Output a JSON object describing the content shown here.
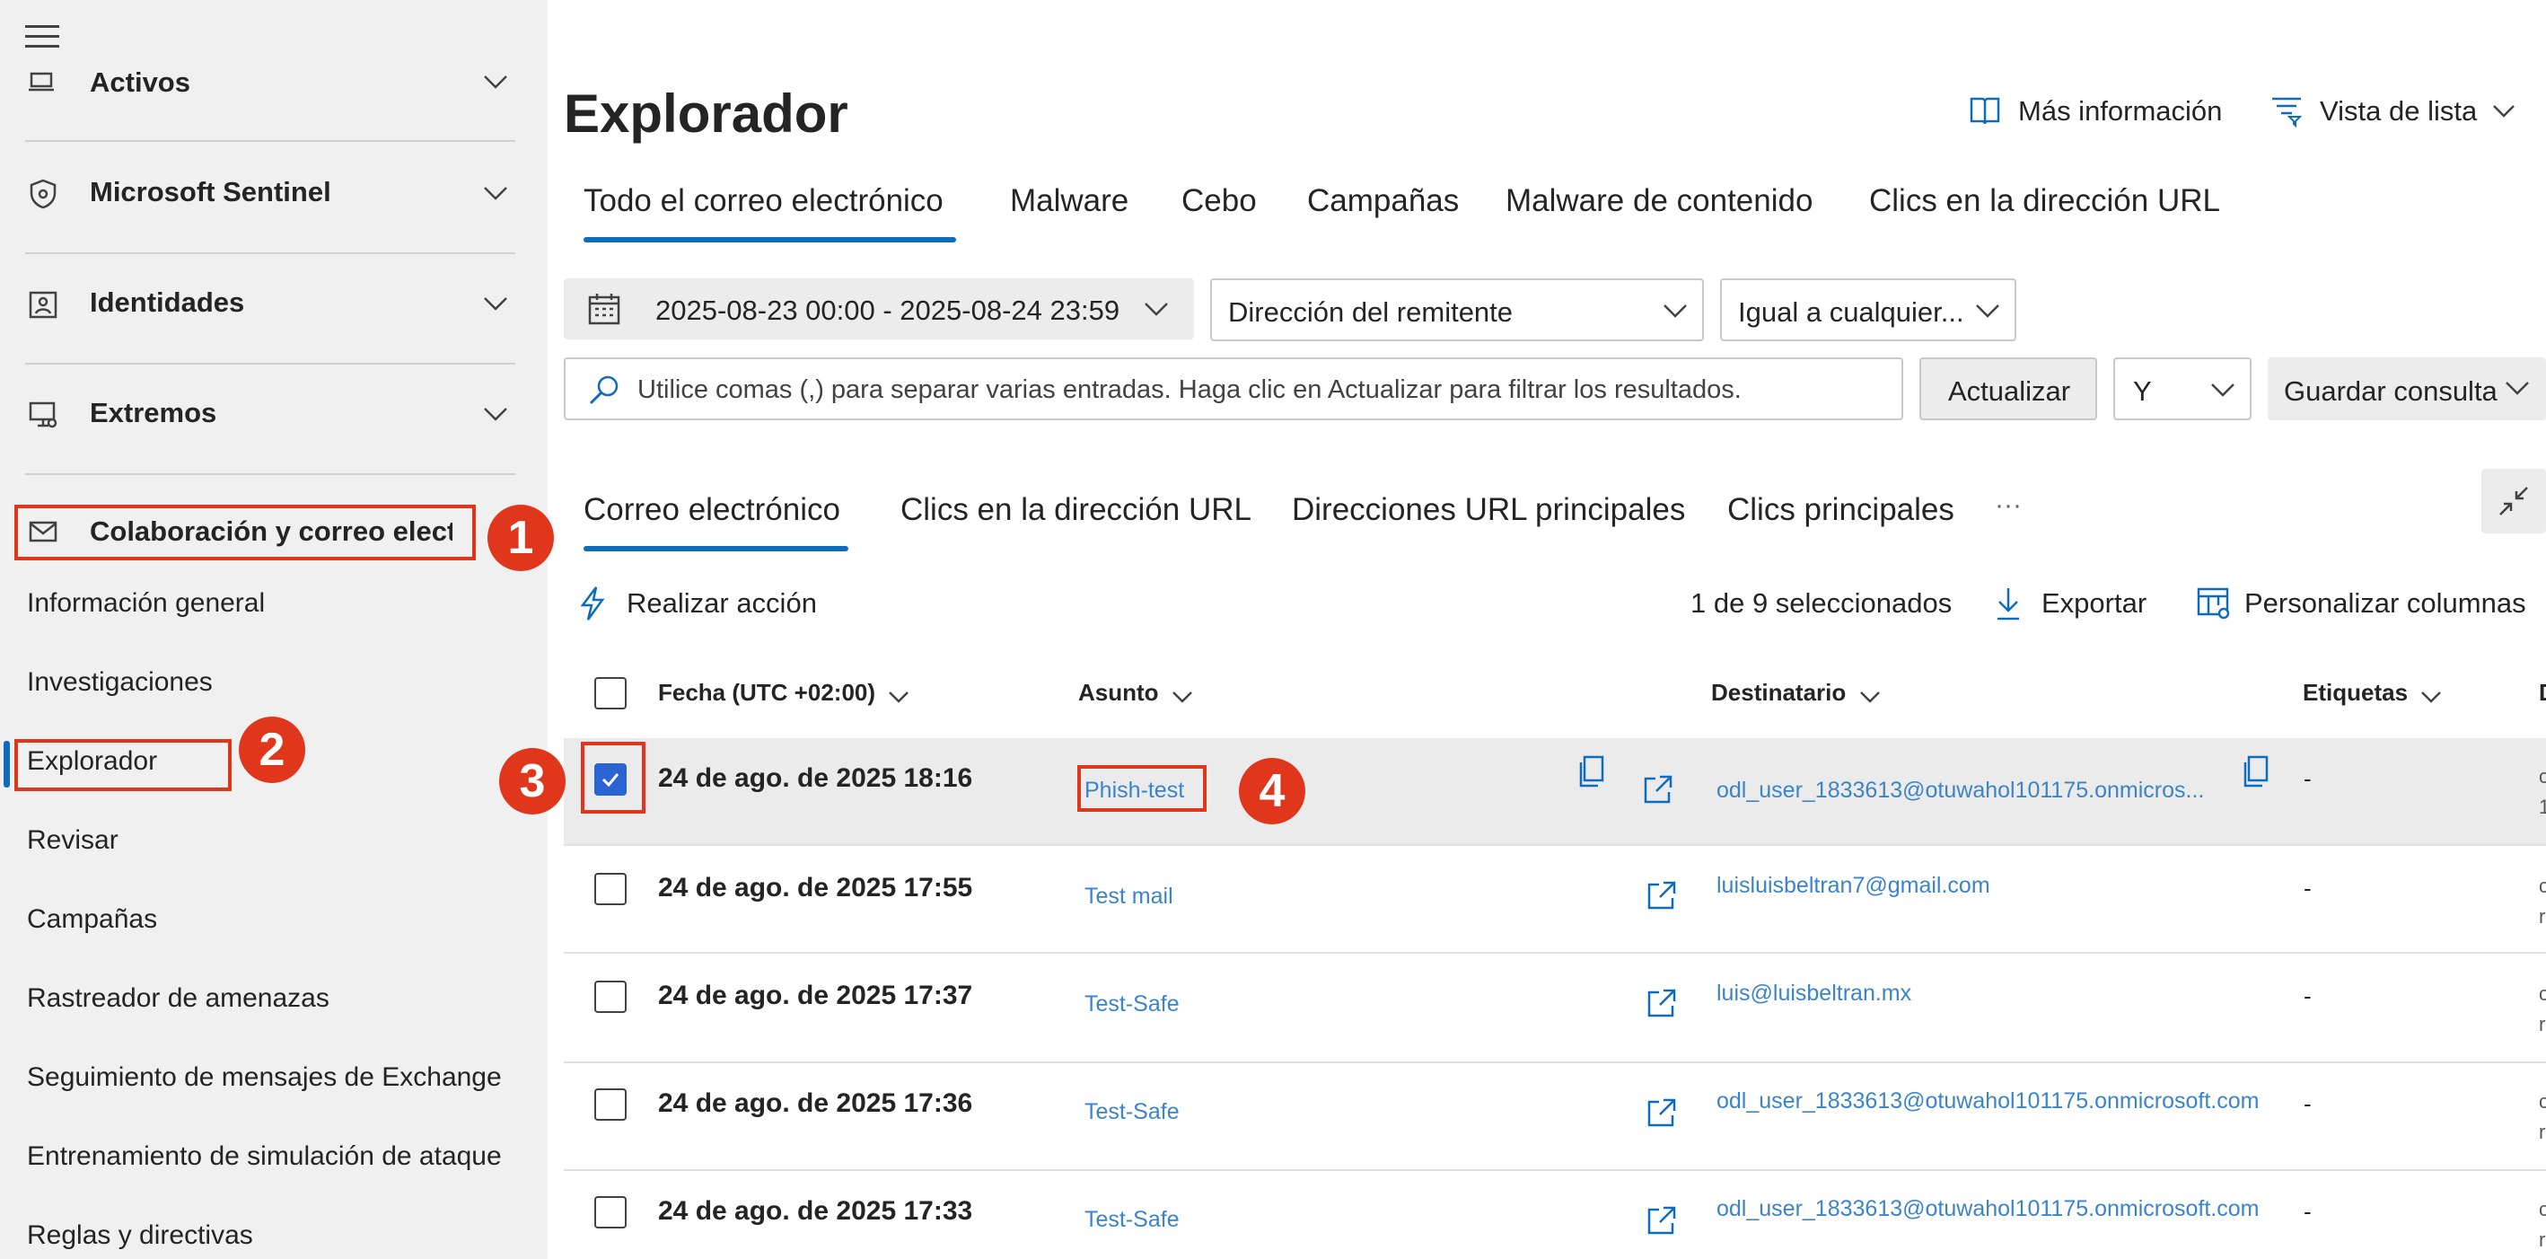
{
  "sidebar": {
    "groups": [
      {
        "label": "Activos",
        "icon": "devices-icon"
      },
      {
        "label": "Microsoft Sentinel",
        "icon": "shield-eye-icon"
      },
      {
        "label": "Identidades",
        "icon": "identity-card-icon"
      },
      {
        "label": "Extremos",
        "icon": "endpoint-device-icon"
      },
      {
        "label": "Colaboración y correo electró",
        "icon": "mail-icon"
      }
    ],
    "items": [
      {
        "label": "Información general"
      },
      {
        "label": "Investigaciones"
      },
      {
        "label": "Explorador"
      },
      {
        "label": "Revisar"
      },
      {
        "label": "Campañas"
      },
      {
        "label": "Rastreador de amenazas"
      },
      {
        "label": "Seguimiento de mensajes de Exchange"
      },
      {
        "label": "Entrenamiento de simulación de ataque"
      },
      {
        "label": "Reglas y directivas"
      }
    ]
  },
  "badges": [
    "1",
    "2",
    "3",
    "4"
  ],
  "header": {
    "title": "Explorador",
    "more_info": "Más información",
    "list_view": "Vista de lista"
  },
  "tabs": [
    {
      "label": "Todo el correo electrónico"
    },
    {
      "label": "Malware"
    },
    {
      "label": "Cebo"
    },
    {
      "label": "Campañas"
    },
    {
      "label": "Malware de contenido"
    },
    {
      "label": "Clics en la dirección URL"
    }
  ],
  "filters": {
    "date_range": "2025-08-23 00:00 - 2025-08-24 23:59",
    "field": "Dirección del remitente",
    "operator": "Igual a cualquier...",
    "search_placeholder": "Utilice comas (,) para separar varias entradas. Haga clic en Actualizar para filtrar los resultados.",
    "refresh": "Actualizar",
    "logic": "Y",
    "save_query": "Guardar consulta"
  },
  "subtabs": [
    {
      "label": "Correo electrónico"
    },
    {
      "label": "Clics en la dirección URL"
    },
    {
      "label": "Direcciones URL principales"
    },
    {
      "label": "Clics principales"
    }
  ],
  "subtabs_more": "···",
  "toolbar": {
    "take_action": "Realizar acción",
    "selection": "1 de 9 seleccionados",
    "export": "Exportar",
    "customize": "Personalizar columnas"
  },
  "columns": {
    "date": "Fecha (UTC +02:00)",
    "subject": "Asunto",
    "recipient": "Destinatario",
    "tags": "Etiquetas",
    "next": "D"
  },
  "rows": [
    {
      "date": "24 de ago. de 2025 18:16",
      "subject": "Phish-test",
      "recipient": "odl_user_1833613@otuwahol101175.onmicros...",
      "tags": "-",
      "edge": "c",
      "edge2": "1",
      "checked": true
    },
    {
      "date": "24 de ago. de 2025 17:55",
      "subject": "Test mail",
      "recipient": "luisluisbeltran7@gmail.com",
      "tags": "-",
      "edge": "c",
      "edge2": "r",
      "checked": false
    },
    {
      "date": "24 de ago. de 2025 17:37",
      "subject": "Test-Safe",
      "recipient": "luis@luisbeltran.mx",
      "tags": "-",
      "edge": "c",
      "edge2": "r",
      "checked": false
    },
    {
      "date": "24 de ago. de 2025 17:36",
      "subject": "Test-Safe",
      "recipient": "odl_user_1833613@otuwahol101175.onmicrosoft.com",
      "tags": "-",
      "edge": "c",
      "edge2": "r",
      "checked": false
    },
    {
      "date": "24 de ago. de 2025 17:33",
      "subject": "Test-Safe",
      "recipient": "odl_user_1833613@otuwahol101175.onmicrosoft.com",
      "tags": "-",
      "edge": "c",
      "edge2": "r",
      "checked": false
    }
  ],
  "colors": {
    "accent": "#0f6cbd",
    "annotation_red": "#e0361c",
    "link": "#3b84c8",
    "checkbox_checked": "#2b63d1"
  }
}
